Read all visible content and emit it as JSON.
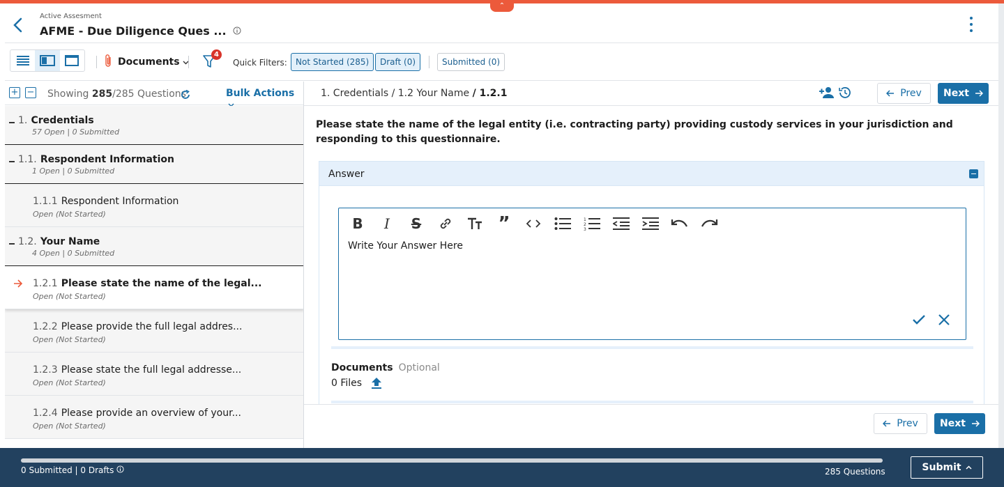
{
  "header": {
    "supertitle": "Active Assesment",
    "title": "AFME - Due Diligence Ques ..."
  },
  "toolbar": {
    "documents_label": "Documents",
    "filter_count": "4",
    "quick_filters_label": "Quick Filters:",
    "chips": [
      {
        "label": "Not Started (285)",
        "active": true
      },
      {
        "label": "Draft (0)",
        "active": true
      },
      {
        "label": "Submitted (0)",
        "active": false
      }
    ]
  },
  "list": {
    "showing_prefix": "Showing",
    "showing_count": "285",
    "showing_suffix": "/285 Questions",
    "bulk_actions": "Bulk Actions",
    "nodes": [
      {
        "kind": "section",
        "num": "1.",
        "label": "Credentials",
        "sub": "57 Open | 0 Submitted"
      },
      {
        "kind": "section",
        "num": "1.1.",
        "label": "Respondent Information",
        "sub": "1 Open | 0 Submitted"
      },
      {
        "kind": "item",
        "num": "1.1.1",
        "label": "Respondent Information",
        "sub": "Open  (Not Started)"
      },
      {
        "kind": "section",
        "num": "1.2.",
        "label": "Your Name",
        "sub": "4 Open | 0 Submitted"
      },
      {
        "kind": "item-active",
        "num": "1.2.1",
        "label": "Please state the name of the legal...",
        "sub": "Open  (Not Started)"
      },
      {
        "kind": "item",
        "num": "1.2.2",
        "label": "Please provide the full legal addres...",
        "sub": "Open  (Not Started)"
      },
      {
        "kind": "item",
        "num": "1.2.3",
        "label": "Please state the full legal addresse...",
        "sub": "Open  (Not Started)"
      },
      {
        "kind": "item",
        "num": "1.2.4",
        "label": "Please provide an overview of your...",
        "sub": "Open  (Not Started)"
      }
    ]
  },
  "detail": {
    "crumb_prefix": "1. Credentials / 1.2 Your Name",
    "crumb_current": "/ 1.2.1",
    "prev_label": "Prev",
    "next_label": "Next",
    "question": "Please state the name of the legal entity (i.e. contracting party) providing custody services in your jurisdiction and responding to this questionnaire.",
    "answer_header": "Answer",
    "editor_placeholder": "Write Your Answer Here",
    "documents_label": "Documents",
    "documents_optional": "Optional",
    "files_label": "0 Files"
  },
  "footer": {
    "status": "0 Submitted | 0 Drafts",
    "progress": 0,
    "questions": "285 Questions",
    "submit": "Submit"
  },
  "colors": {
    "accent": "#1a6fa7",
    "brand_orange": "#ec5a3b",
    "footer_bg": "#22415f"
  }
}
